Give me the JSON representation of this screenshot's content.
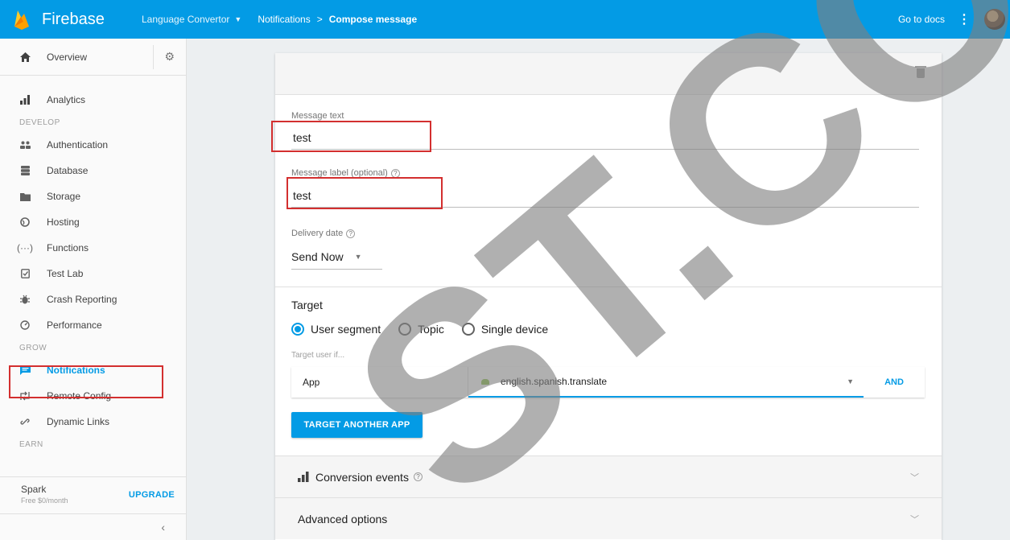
{
  "header": {
    "brand": "Firebase",
    "project": "Language Convertor",
    "breadcrumb": [
      "Notifications",
      "Compose message"
    ],
    "separator": ">",
    "docs_label": "Go to docs"
  },
  "sidebar": {
    "overview": "Overview",
    "analytics": "Analytics",
    "develop_label": "DEVELOP",
    "develop": [
      "Authentication",
      "Database",
      "Storage",
      "Hosting",
      "Functions",
      "Test Lab",
      "Crash Reporting",
      "Performance"
    ],
    "grow_label": "GROW",
    "grow": [
      "Notifications",
      "Remote Config",
      "Dynamic Links"
    ],
    "earn_label": "EARN",
    "plan_name": "Spark",
    "plan_price": "Free $0/month",
    "upgrade": "UPGRADE"
  },
  "form": {
    "message_text_label": "Message text",
    "message_text_value": "test",
    "message_label_label": "Message label (optional)",
    "message_label_value": "test",
    "delivery_label": "Delivery date",
    "delivery_value": "Send Now",
    "target_title": "Target",
    "radios": [
      "User segment",
      "Topic",
      "Single device"
    ],
    "selected_radio": "User segment",
    "target_if": "Target user if...",
    "condition_key": "App",
    "condition_value": "english.spanish.translate",
    "and_label": "AND",
    "target_another": "TARGET ANOTHER APP",
    "conversion_events": "Conversion events",
    "advanced_options": "Advanced options"
  },
  "watermark": {
    "text": "ST.CC"
  }
}
